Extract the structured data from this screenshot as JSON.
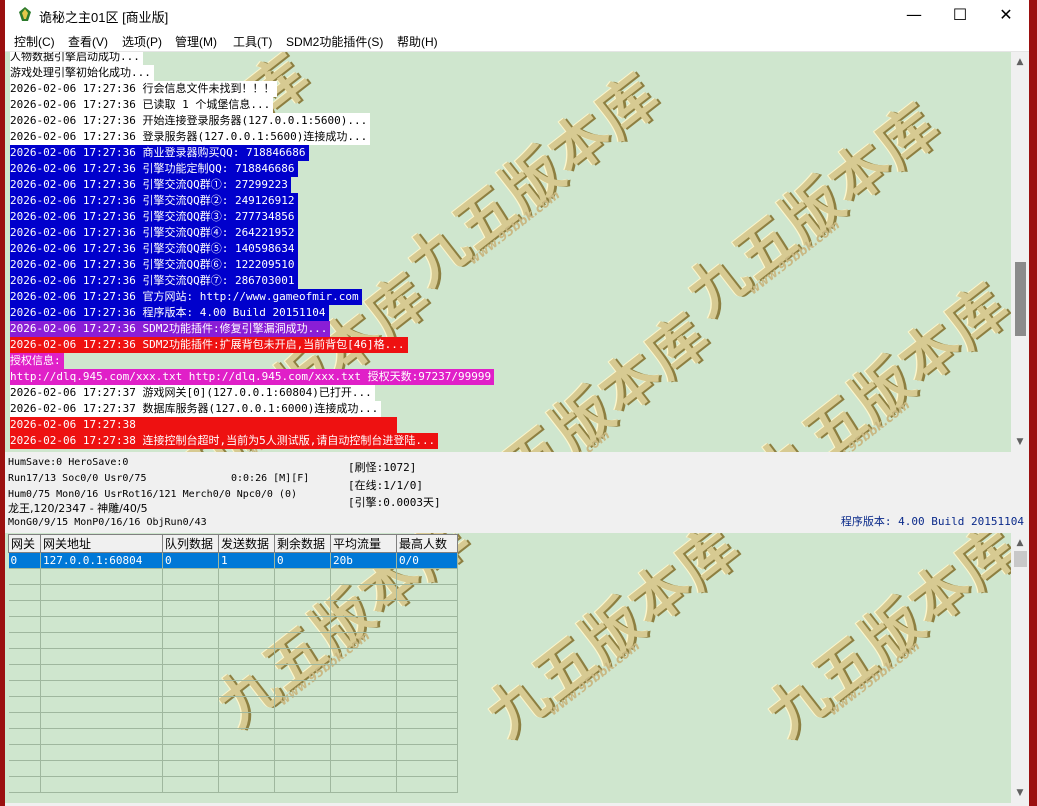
{
  "window": {
    "title": "诡秘之主01区 [商业版]",
    "controls": {
      "minimize": "—",
      "maximize": "☐",
      "close": "✕"
    }
  },
  "menu": [
    "控制(C)",
    "查看(V)",
    "选项(P)",
    "管理(M)",
    "工具(T)",
    "SDM2功能插件(S)",
    "帮助(H)"
  ],
  "watermark": {
    "text": "九五版本库",
    "url": "www.95bbk.com"
  },
  "log": [
    {
      "text": "人物数据引擎启动成功...",
      "bg": "#ffffff",
      "fg": "#000000"
    },
    {
      "text": "游戏处理引擎初始化成功...",
      "bg": "#ffffff",
      "fg": "#000000"
    },
    {
      "text": "2026-02-06 17:27:36 行会信息文件未找到！！！",
      "bg": "#ffffff",
      "fg": "#000000"
    },
    {
      "text": "2026-02-06 17:27:36 已读取 1 个城堡信息...",
      "bg": "#ffffff",
      "fg": "#000000"
    },
    {
      "text": "2026-02-06 17:27:36 开始连接登录服务器(127.0.0.1:5600)...",
      "bg": "#ffffff",
      "fg": "#000000"
    },
    {
      "text": "2026-02-06 17:27:36 登录服务器(127.0.0.1:5600)连接成功...",
      "bg": "#ffffff",
      "fg": "#000000"
    },
    {
      "text": "2026-02-06 17:27:36 商业登录器购买QQ: 718846686",
      "bg": "#0000cc",
      "fg": "#ffffff"
    },
    {
      "text": "2026-02-06 17:27:36 引擎功能定制QQ: 718846686",
      "bg": "#0000cc",
      "fg": "#ffffff"
    },
    {
      "text": "2026-02-06 17:27:36 引擎交流QQ群①: 27299223",
      "bg": "#0000cc",
      "fg": "#ffffff"
    },
    {
      "text": "2026-02-06 17:27:36 引擎交流QQ群②: 249126912",
      "bg": "#0000cc",
      "fg": "#ffffff"
    },
    {
      "text": "2026-02-06 17:27:36 引擎交流QQ群③: 277734856",
      "bg": "#0000cc",
      "fg": "#ffffff"
    },
    {
      "text": "2026-02-06 17:27:36 引擎交流QQ群④: 264221952",
      "bg": "#0000cc",
      "fg": "#ffffff"
    },
    {
      "text": "2026-02-06 17:27:36 引擎交流QQ群⑤: 140598634",
      "bg": "#0000cc",
      "fg": "#ffffff"
    },
    {
      "text": "2026-02-06 17:27:36 引擎交流QQ群⑥: 122209510",
      "bg": "#0000cc",
      "fg": "#ffffff"
    },
    {
      "text": "2026-02-06 17:27:36 引擎交流QQ群⑦: 286703001",
      "bg": "#0000cc",
      "fg": "#ffffff"
    },
    {
      "text": "2026-02-06 17:27:36 官方网站: http://www.gameofmir.com",
      "bg": "#0000cc",
      "fg": "#ffffff"
    },
    {
      "text": "2026-02-06 17:27:36 程序版本: 4.00 Build 20151104",
      "bg": "#0000cc",
      "fg": "#ffffff"
    },
    {
      "text": "2026-02-06 17:27:36 SDM2功能插件:修复引擎漏洞成功...",
      "bg": "#8a1ed6",
      "fg": "#ffffff"
    },
    {
      "text": "2026-02-06 17:27:36 SDM2功能插件:扩展背包未开启,当前背包[46]格...",
      "bg": "#ee1111",
      "fg": "#ffffff"
    },
    {
      "text": "授权信息:",
      "bg": "#e020c8",
      "fg": "#ffffff"
    },
    {
      "text": "http://dlq.945.com/xxx.txt http://dlq.945.com/xxx.txt 授权天数:97237/99999",
      "bg": "#e020c8",
      "fg": "#ffffff"
    },
    {
      "text": "2026-02-06 17:27:37 游戏网关[0](127.0.0.1:60804)已打开...",
      "bg": "#ffffff",
      "fg": "#000000"
    },
    {
      "text": "2026-02-06 17:27:37 数据库服务器(127.0.0.1:6000)连接成功...",
      "bg": "#ffffff",
      "fg": "#000000"
    },
    {
      "text": "2026-02-06 17:27:38                                       ",
      "bg": "#ee1111",
      "fg": "#ffffff"
    },
    {
      "text": "2026-02-06 17:27:38 连接控制台超时,当前为5人测试版,请自动控制台进登陆...",
      "bg": "#ee1111",
      "fg": "#ffffff"
    }
  ],
  "status": {
    "line1": "HumSave:0 HeroSave:0",
    "line2": "Run17/13 Soc0/0 Usr0/75",
    "time": "0:0:26 [M][F]",
    "line3": "Hum0/75 Mon0/16 UsrRot16/121 Merch0/0 Npc0/0 (0)",
    "line4": "龙王,120/2347 - 神雕/40/5",
    "line5": "MonG0/9/15 MonP0/16/16 ObjRun0/43",
    "refresh": "[刷怪:1072]",
    "online": "[在线:1/1/0]",
    "engine": "[引擎:0.0003天]",
    "version": "程序版本: 4.00 Build 20151104"
  },
  "gateway_table": {
    "columns": [
      "网关",
      "网关地址",
      "队列数据",
      "发送数据",
      "剩余数据",
      "平均流量",
      "最高人数"
    ],
    "rows": [
      [
        "0",
        "127.0.0.1:60804",
        "0",
        "1",
        "0",
        "20b",
        "0/0"
      ]
    ]
  },
  "colors": {
    "panel_bg": "#cfe6ce",
    "selection": "#0078d7",
    "desktop": "#9b1010"
  }
}
